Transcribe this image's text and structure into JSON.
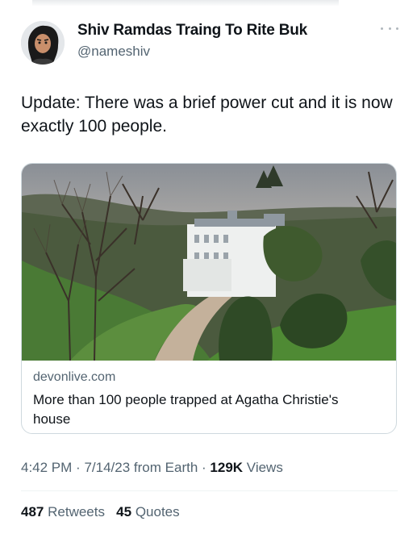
{
  "author": {
    "display_name": "Shiv Ramdas Traing To Rite Buk",
    "handle": "@nameshiv",
    "avatar_icon": "cartoon-avatar-icon",
    "more_icon": "more-options-icon"
  },
  "tweet": {
    "text": "Update: There was a brief power cut and it is now exactly 100 people."
  },
  "link_card": {
    "image_icon": "mansion-photo",
    "domain": "devonlive.com",
    "title": "More than 100 people trapped at Agatha Christie's house"
  },
  "meta": {
    "time": "4:42 PM",
    "date": "7/14/23",
    "source": "from Earth",
    "views_count": "129K",
    "views_label": "Views"
  },
  "stats": {
    "retweets_count": "487",
    "retweets_label": "Retweets",
    "quotes_count": "45",
    "quotes_label": "Quotes"
  },
  "colors": {
    "text": "#0f1419",
    "secondary": "#536471",
    "border": "#cfd9de"
  }
}
